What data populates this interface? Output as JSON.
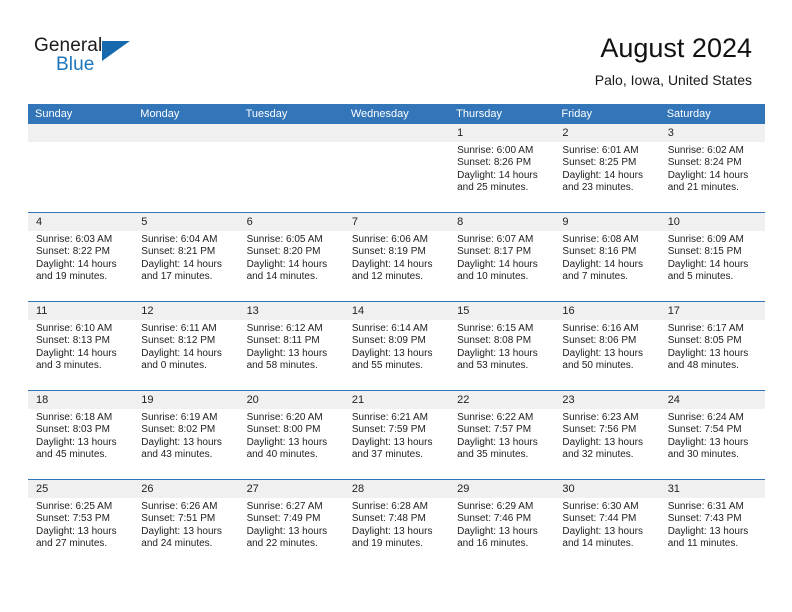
{
  "brand": {
    "name_part1": "General",
    "name_part2": "Blue"
  },
  "header": {
    "title": "August 2024",
    "subtitle": "Palo, Iowa, United States"
  },
  "colors": {
    "header_blue": "#3275b8",
    "brand_blue": "#1d74bb",
    "date_band": "#f0f0f0",
    "text": "#222222"
  },
  "weekdays": [
    "Sunday",
    "Monday",
    "Tuesday",
    "Wednesday",
    "Thursday",
    "Friday",
    "Saturday"
  ],
  "weeks": [
    {
      "days": [
        {
          "num": "",
          "lines": [
            "",
            "",
            "",
            ""
          ]
        },
        {
          "num": "",
          "lines": [
            "",
            "",
            "",
            ""
          ]
        },
        {
          "num": "",
          "lines": [
            "",
            "",
            "",
            ""
          ]
        },
        {
          "num": "",
          "lines": [
            "",
            "",
            "",
            ""
          ]
        },
        {
          "num": "1",
          "lines": [
            "Sunrise: 6:00 AM",
            "Sunset: 8:26 PM",
            "Daylight: 14 hours",
            "and 25 minutes."
          ]
        },
        {
          "num": "2",
          "lines": [
            "Sunrise: 6:01 AM",
            "Sunset: 8:25 PM",
            "Daylight: 14 hours",
            "and 23 minutes."
          ]
        },
        {
          "num": "3",
          "lines": [
            "Sunrise: 6:02 AM",
            "Sunset: 8:24 PM",
            "Daylight: 14 hours",
            "and 21 minutes."
          ]
        }
      ]
    },
    {
      "days": [
        {
          "num": "4",
          "lines": [
            "Sunrise: 6:03 AM",
            "Sunset: 8:22 PM",
            "Daylight: 14 hours",
            "and 19 minutes."
          ]
        },
        {
          "num": "5",
          "lines": [
            "Sunrise: 6:04 AM",
            "Sunset: 8:21 PM",
            "Daylight: 14 hours",
            "and 17 minutes."
          ]
        },
        {
          "num": "6",
          "lines": [
            "Sunrise: 6:05 AM",
            "Sunset: 8:20 PM",
            "Daylight: 14 hours",
            "and 14 minutes."
          ]
        },
        {
          "num": "7",
          "lines": [
            "Sunrise: 6:06 AM",
            "Sunset: 8:19 PM",
            "Daylight: 14 hours",
            "and 12 minutes."
          ]
        },
        {
          "num": "8",
          "lines": [
            "Sunrise: 6:07 AM",
            "Sunset: 8:17 PM",
            "Daylight: 14 hours",
            "and 10 minutes."
          ]
        },
        {
          "num": "9",
          "lines": [
            "Sunrise: 6:08 AM",
            "Sunset: 8:16 PM",
            "Daylight: 14 hours",
            "and 7 minutes."
          ]
        },
        {
          "num": "10",
          "lines": [
            "Sunrise: 6:09 AM",
            "Sunset: 8:15 PM",
            "Daylight: 14 hours",
            "and 5 minutes."
          ]
        }
      ]
    },
    {
      "days": [
        {
          "num": "11",
          "lines": [
            "Sunrise: 6:10 AM",
            "Sunset: 8:13 PM",
            "Daylight: 14 hours",
            "and 3 minutes."
          ]
        },
        {
          "num": "12",
          "lines": [
            "Sunrise: 6:11 AM",
            "Sunset: 8:12 PM",
            "Daylight: 14 hours",
            "and 0 minutes."
          ]
        },
        {
          "num": "13",
          "lines": [
            "Sunrise: 6:12 AM",
            "Sunset: 8:11 PM",
            "Daylight: 13 hours",
            "and 58 minutes."
          ]
        },
        {
          "num": "14",
          "lines": [
            "Sunrise: 6:14 AM",
            "Sunset: 8:09 PM",
            "Daylight: 13 hours",
            "and 55 minutes."
          ]
        },
        {
          "num": "15",
          "lines": [
            "Sunrise: 6:15 AM",
            "Sunset: 8:08 PM",
            "Daylight: 13 hours",
            "and 53 minutes."
          ]
        },
        {
          "num": "16",
          "lines": [
            "Sunrise: 6:16 AM",
            "Sunset: 8:06 PM",
            "Daylight: 13 hours",
            "and 50 minutes."
          ]
        },
        {
          "num": "17",
          "lines": [
            "Sunrise: 6:17 AM",
            "Sunset: 8:05 PM",
            "Daylight: 13 hours",
            "and 48 minutes."
          ]
        }
      ]
    },
    {
      "days": [
        {
          "num": "18",
          "lines": [
            "Sunrise: 6:18 AM",
            "Sunset: 8:03 PM",
            "Daylight: 13 hours",
            "and 45 minutes."
          ]
        },
        {
          "num": "19",
          "lines": [
            "Sunrise: 6:19 AM",
            "Sunset: 8:02 PM",
            "Daylight: 13 hours",
            "and 43 minutes."
          ]
        },
        {
          "num": "20",
          "lines": [
            "Sunrise: 6:20 AM",
            "Sunset: 8:00 PM",
            "Daylight: 13 hours",
            "and 40 minutes."
          ]
        },
        {
          "num": "21",
          "lines": [
            "Sunrise: 6:21 AM",
            "Sunset: 7:59 PM",
            "Daylight: 13 hours",
            "and 37 minutes."
          ]
        },
        {
          "num": "22",
          "lines": [
            "Sunrise: 6:22 AM",
            "Sunset: 7:57 PM",
            "Daylight: 13 hours",
            "and 35 minutes."
          ]
        },
        {
          "num": "23",
          "lines": [
            "Sunrise: 6:23 AM",
            "Sunset: 7:56 PM",
            "Daylight: 13 hours",
            "and 32 minutes."
          ]
        },
        {
          "num": "24",
          "lines": [
            "Sunrise: 6:24 AM",
            "Sunset: 7:54 PM",
            "Daylight: 13 hours",
            "and 30 minutes."
          ]
        }
      ]
    },
    {
      "days": [
        {
          "num": "25",
          "lines": [
            "Sunrise: 6:25 AM",
            "Sunset: 7:53 PM",
            "Daylight: 13 hours",
            "and 27 minutes."
          ]
        },
        {
          "num": "26",
          "lines": [
            "Sunrise: 6:26 AM",
            "Sunset: 7:51 PM",
            "Daylight: 13 hours",
            "and 24 minutes."
          ]
        },
        {
          "num": "27",
          "lines": [
            "Sunrise: 6:27 AM",
            "Sunset: 7:49 PM",
            "Daylight: 13 hours",
            "and 22 minutes."
          ]
        },
        {
          "num": "28",
          "lines": [
            "Sunrise: 6:28 AM",
            "Sunset: 7:48 PM",
            "Daylight: 13 hours",
            "and 19 minutes."
          ]
        },
        {
          "num": "29",
          "lines": [
            "Sunrise: 6:29 AM",
            "Sunset: 7:46 PM",
            "Daylight: 13 hours",
            "and 16 minutes."
          ]
        },
        {
          "num": "30",
          "lines": [
            "Sunrise: 6:30 AM",
            "Sunset: 7:44 PM",
            "Daylight: 13 hours",
            "and 14 minutes."
          ]
        },
        {
          "num": "31",
          "lines": [
            "Sunrise: 6:31 AM",
            "Sunset: 7:43 PM",
            "Daylight: 13 hours",
            "and 11 minutes."
          ]
        }
      ]
    }
  ]
}
